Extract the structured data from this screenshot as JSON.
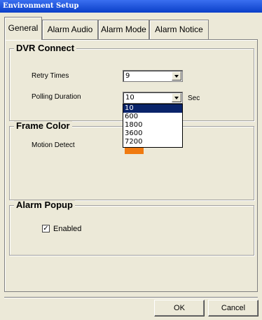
{
  "window": {
    "title": "Environment Setup"
  },
  "tabs": [
    {
      "label": "General"
    },
    {
      "label": "Alarm Audio"
    },
    {
      "label": "Alarm Mode"
    },
    {
      "label": "Alarm Notice"
    }
  ],
  "dvr_connect": {
    "title": "DVR Connect",
    "retry_label": "Retry Times",
    "retry_value": "9",
    "polling_label": "Polling Duration",
    "polling_value": "10",
    "polling_unit": "Sec",
    "polling_options": [
      "10",
      "600",
      "1800",
      "3600",
      "7200"
    ]
  },
  "frame_color": {
    "title": "Frame Color",
    "motion_label": "Motion Detect",
    "motion_color": "#f07a10"
  },
  "alarm_popup": {
    "title": "Alarm Popup",
    "enabled_label": "Enabled",
    "enabled_checked": true
  },
  "footer": {
    "ok_label": "OK",
    "cancel_label": "Cancel"
  }
}
